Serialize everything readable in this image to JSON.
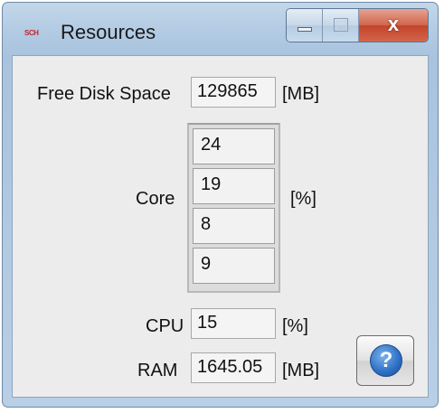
{
  "window": {
    "title": "Resources",
    "icon_text": "SCH",
    "close_glyph": "x"
  },
  "disk": {
    "label": "Free Disk Space",
    "value": "129865",
    "unit": "[MB]"
  },
  "core": {
    "label": "Core",
    "values": [
      "24",
      "19",
      "8",
      "9"
    ],
    "unit": "[%]"
  },
  "cpu": {
    "label": "CPU",
    "value": "15",
    "unit": "[%]"
  },
  "ram": {
    "label": "RAM",
    "value": "1645.05",
    "unit": "[MB]"
  },
  "help": {
    "glyph": "?"
  },
  "colors": {
    "title_bar": "#b3cbe3",
    "close_button": "#c2442b",
    "help_icon": "#2b6fc4"
  }
}
